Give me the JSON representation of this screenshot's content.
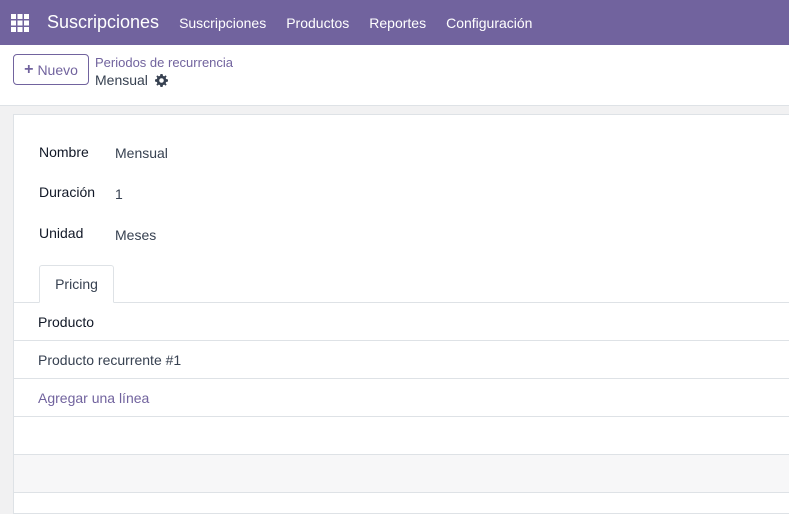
{
  "navbar": {
    "app_name": "Suscripciones",
    "menu": [
      "Suscripciones",
      "Productos",
      "Reportes",
      "Configuración"
    ]
  },
  "control_panel": {
    "new_button_label": "Nuevo",
    "breadcrumb_parent": "Periodos de recurrencia",
    "record_title": "Mensual"
  },
  "form": {
    "fields": [
      {
        "label": "Nombre",
        "value": "Mensual"
      },
      {
        "label": "Duración",
        "value": "1"
      },
      {
        "label": "Unidad",
        "value": "Meses"
      }
    ],
    "tab_label": "Pricing",
    "table": {
      "column_header": "Producto",
      "rows": [
        "Producto recurrente #1"
      ],
      "add_line_label": "Agregar una línea"
    }
  },
  "colors": {
    "navbar": "#71639e",
    "accent": "#71639e",
    "page_background": "#f1f1f2"
  },
  "icons": [
    "apps-grid-icon",
    "plus-icon",
    "gear-icon"
  ]
}
